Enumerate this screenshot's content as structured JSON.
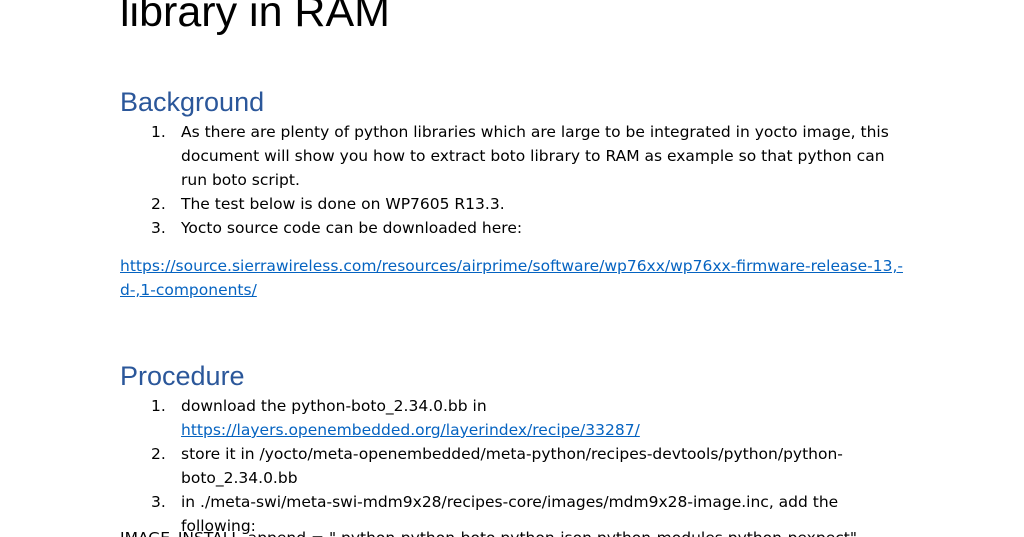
{
  "document": {
    "title": "library in RAM",
    "sections": {
      "background": {
        "heading": "Background",
        "items": [
          {
            "num": "1.",
            "text": "As there are plenty of python libraries which are large to be integrated in yocto image, this document will show you how to extract boto library to RAM as example so that python can run boto script."
          },
          {
            "num": "2.",
            "text": "The test below is done on WP7605 R13.3."
          },
          {
            "num": "3.",
            "text": "Yocto source code can be downloaded here:"
          }
        ],
        "link": "https://source.sierrawireless.com/resources/airprime/software/wp76xx/wp76xx-firmware-release-13,-d-,1-components/"
      },
      "procedure": {
        "heading": "Procedure",
        "items": [
          {
            "num": "1.",
            "text": "download the python-boto_2.34.0.bb in",
            "link": "https://layers.openembedded.org/layerindex/recipe/33287/"
          },
          {
            "num": "2.",
            "text": "store it in /yocto/meta-openembedded/meta-python/recipes-devtools/python/python-boto_2.34.0.bb"
          },
          {
            "num": "3.",
            "text": "in ./meta-swi/meta-swi-mdm9x28/recipes-core/images/mdm9x28-image.inc, add the following:"
          }
        ],
        "code_line": "IMAGE_INSTALL_append = \" python-python-boto python-json python-modules python-pexpect\""
      }
    }
  }
}
